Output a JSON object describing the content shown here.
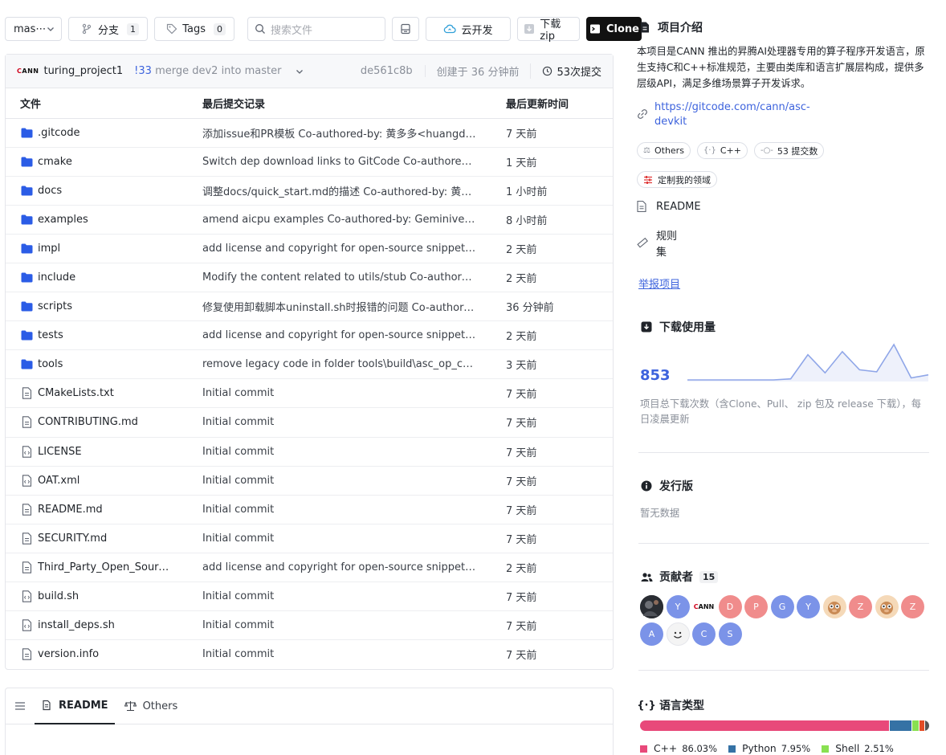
{
  "toolbar": {
    "branch": "mas⋯",
    "branches_label": "分支",
    "branches_count": "1",
    "tags_label": "Tags",
    "tags_count": "0",
    "search_placeholder": "搜索文件",
    "cloud_label": "云开发",
    "zip_label": "下载zip",
    "clone_label": "Clone"
  },
  "commit": {
    "user": "turing_project1",
    "issue": "!33",
    "message": "merge dev2 into master",
    "hash": "de561c8b",
    "created": "创建于 36 分钟前",
    "count": "53次提交"
  },
  "table": {
    "headers": [
      "文件",
      "最后提交记录",
      "最后更新时间"
    ],
    "rows": [
      {
        "type": "folder",
        "name": ".gitcode",
        "msg": "添加issue和PR模板 Co-authored-by: 黄多多<huangduo4…",
        "time": "7 天前"
      },
      {
        "type": "folder",
        "name": "cmake",
        "msg": "Switch dep download links to GitCode Co-authored-by: …",
        "time": "1 天前"
      },
      {
        "type": "folder",
        "name": "docs",
        "msg": "调整docs/quick_start.md的描述 Co-authored-by: 黄多多…",
        "time": "1 小时前"
      },
      {
        "type": "folder",
        "name": "examples",
        "msg": "amend aicpu examples Co-authored-by: Geminiver<zhe…",
        "time": "8 小时前"
      },
      {
        "type": "folder",
        "name": "impl",
        "msg": "add license and copyright for open-source snippets Co-a…",
        "time": "2 天前"
      },
      {
        "type": "folder",
        "name": "include",
        "msg": "Modify the content related to utils/stub Co-authored-by:…",
        "time": "2 天前"
      },
      {
        "type": "folder",
        "name": "scripts",
        "msg": "修复使用卸载脚本uninstall.sh时报错的问题 Co-authored-…",
        "time": "36 分钟前"
      },
      {
        "type": "folder",
        "name": "tests",
        "msg": "add license and copyright for open-source snippets Co-a…",
        "time": "2 天前"
      },
      {
        "type": "folder",
        "name": "tools",
        "msg": "remove legacy code in folder tools\\build\\asc_op_compil…",
        "time": "3 天前"
      },
      {
        "type": "file",
        "name": "CMakeLists.txt",
        "msg": "Initial commit",
        "time": "7 天前"
      },
      {
        "type": "file",
        "name": "CONTRIBUTING.md",
        "msg": "Initial commit",
        "time": "7 天前"
      },
      {
        "type": "code",
        "name": "LICENSE",
        "msg": "Initial commit",
        "time": "7 天前"
      },
      {
        "type": "code",
        "name": "OAT.xml",
        "msg": "Initial commit",
        "time": "7 天前"
      },
      {
        "type": "file",
        "name": "README.md",
        "msg": "Initial commit",
        "time": "7 天前"
      },
      {
        "type": "file",
        "name": "SECURITY.md",
        "msg": "Initial commit",
        "time": "7 天前"
      },
      {
        "type": "file",
        "name": "Third_Party_Open_Source…",
        "msg": "add license and copyright for open-source snippets Co-a…",
        "time": "2 天前"
      },
      {
        "type": "code",
        "name": "build.sh",
        "msg": "Initial commit",
        "time": "7 天前"
      },
      {
        "type": "code",
        "name": "install_deps.sh",
        "msg": "Initial commit",
        "time": "7 天前"
      },
      {
        "type": "file",
        "name": "version.info",
        "msg": "Initial commit",
        "time": "7 天前"
      }
    ]
  },
  "readme_tabs": [
    "README",
    "Others"
  ],
  "sidebar": {
    "about_title": "项目介绍",
    "description": "本项目是CANN 推出的昇腾AI处理器专用的算子程序开发语言，原生支持C和C++标准规范，主要由类库和语言扩展层构成，提供多层级API，满足多维场景算子开发诉求。",
    "link": "https://gitcode.com/cann/asc-devkit",
    "chips": [
      "Others",
      "C++",
      "53 提交数"
    ],
    "custom_chip": "定制我的领域",
    "readme": "README",
    "rules": "规则集",
    "report": "举报项目",
    "downloads_title": "下载使用量",
    "downloads_count": "853",
    "downloads_series": [
      0,
      0,
      0,
      0,
      0,
      0,
      1,
      25,
      7,
      28,
      10,
      8,
      35,
      2,
      5
    ],
    "downloads_desc": "项目总下载次数（含Clone、Pull、 zip 包及 release 下载），每日凌晨更新",
    "releases_title": "发行版",
    "releases_empty": "暂无数据",
    "contributors_title": "贡献者",
    "contributors_count": "15",
    "contributors": [
      {
        "letter": "",
        "color": "#3a3f47"
      },
      {
        "letter": "Y",
        "color": "#7b93e8"
      },
      {
        "letter": "CANN",
        "color": "#ffffff"
      },
      {
        "letter": "D",
        "color": "#f08c8c"
      },
      {
        "letter": "P",
        "color": "#f08c8c"
      },
      {
        "letter": "G",
        "color": "#7b93e8"
      },
      {
        "letter": "Y",
        "color": "#7b93e8"
      },
      {
        "letter": "",
        "color": "#f5d9b8"
      },
      {
        "letter": "Z",
        "color": "#f08c8c"
      },
      {
        "letter": "",
        "color": "#f5d9b8"
      },
      {
        "letter": "Z",
        "color": "#f08c8c"
      },
      {
        "letter": "A",
        "color": "#7b93e8"
      },
      {
        "letter": "",
        "color": "#f4f4f4"
      },
      {
        "letter": "C",
        "color": "#7b93e8"
      },
      {
        "letter": "S",
        "color": "#7b93e8"
      }
    ],
    "languages_title": "语言类型",
    "languages": [
      {
        "name": "C++",
        "pct": "86.03%",
        "value": 86.03,
        "color": "#e8497a"
      },
      {
        "name": "Python",
        "pct": "7.95%",
        "value": 7.95,
        "color": "#3572a5"
      },
      {
        "name": "Shell",
        "pct": "2.51%",
        "value": 2.51,
        "color": "#89e051"
      }
    ],
    "languages_other": [
      {
        "value": 1.8,
        "color": "#e34c26"
      },
      {
        "value": 1.7,
        "color": "#555555"
      }
    ]
  }
}
